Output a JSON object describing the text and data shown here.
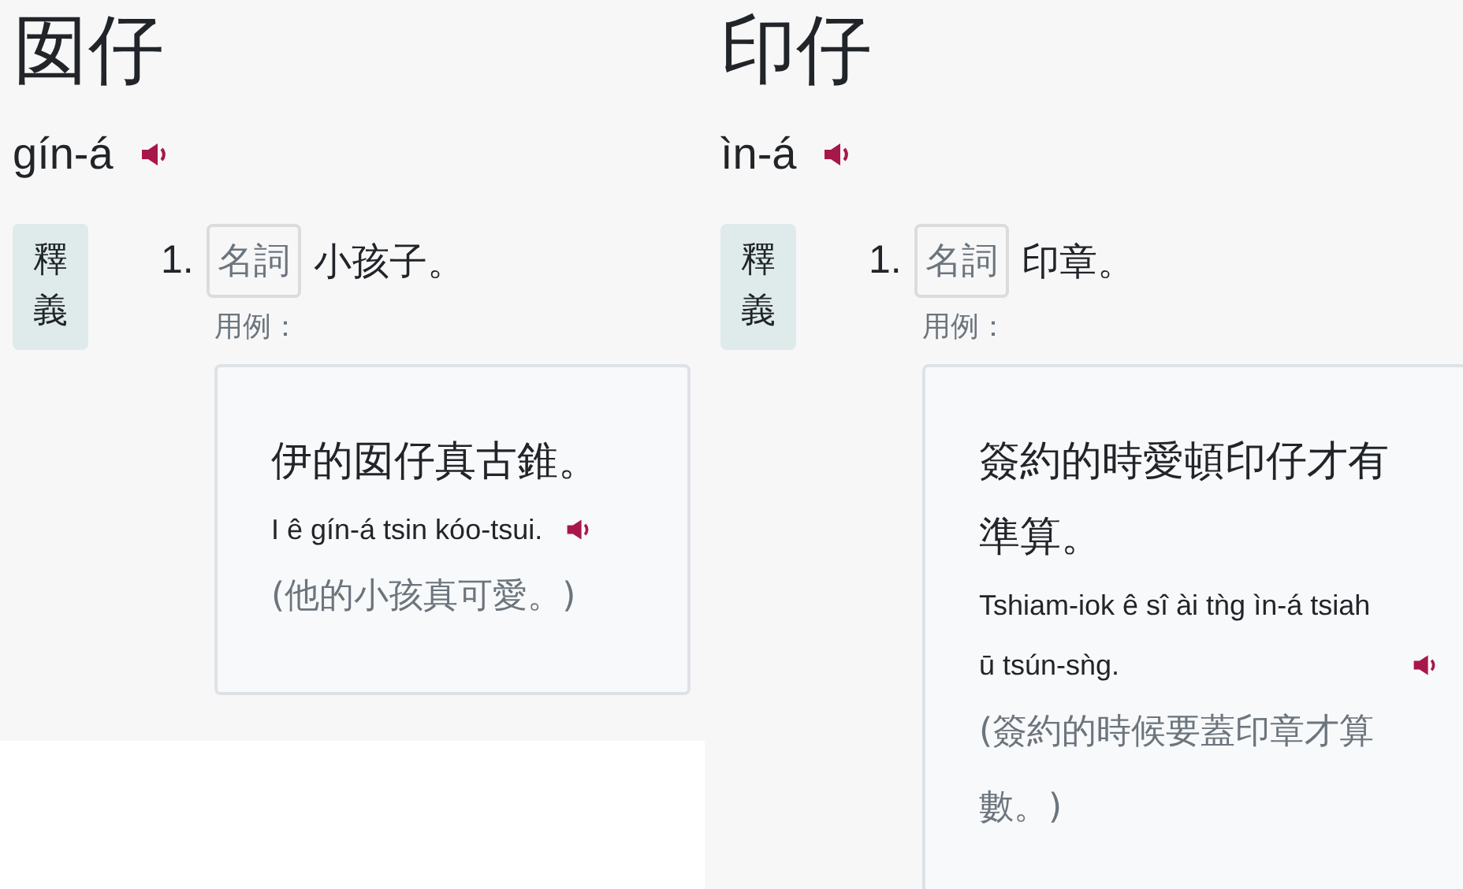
{
  "entries": [
    {
      "headword": "囡仔",
      "pronunciation": "gín-á",
      "section_label": "釋義",
      "senses": [
        {
          "number": "1.",
          "part_of_speech": "名詞",
          "definition": "小孩子。",
          "examples_label": "用例：",
          "examples": [
            {
              "sentence": "伊的囡仔真古錐。",
              "romanization": "I ê gín-á tsin kóo-tsui.",
              "translation": "(他的小孩真可愛。)"
            }
          ]
        }
      ]
    },
    {
      "headword": "印仔",
      "pronunciation": "ìn-á",
      "section_label": "釋義",
      "senses": [
        {
          "number": "1.",
          "part_of_speech": "名詞",
          "definition": "印章。",
          "examples_label": "用例：",
          "examples": [
            {
              "sentence": "簽約的時愛頓印仔才有準算。",
              "romanization": "Tshiam-iok ê sî ài tǹg ìn-á tsiah ū tsún-sǹg.",
              "translation": "(簽約的時候要蓋印章才算數。)"
            }
          ]
        }
      ]
    }
  ]
}
